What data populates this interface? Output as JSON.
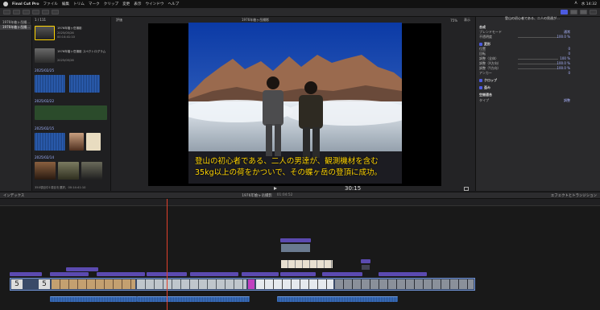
{
  "menubar": {
    "app": "Final Cut Pro",
    "items": [
      "ファイル",
      "編集",
      "トリム",
      "マーク",
      "クリップ",
      "変更",
      "表示",
      "ウインドウ",
      "ヘルプ"
    ],
    "right": [
      "A",
      "水 14:32"
    ]
  },
  "browser": {
    "header": "1 / 111",
    "clips": [
      {
        "title": "1976年槍ヶ岳撮影",
        "meta": "2025/05/26",
        "meta2": "00:14:41:10"
      },
      {
        "title": "1976年槍ヶ岳撮影 スペクトログラム",
        "meta": "2025/05/26",
        "meta2": "00:14:41:10"
      }
    ],
    "dates": [
      "2025/02/25",
      "2025/02/22",
      "2025/02/15",
      "2025/02/14"
    ],
    "footer": "350項目中1項目を選択、00:14:41:10"
  },
  "sidebar": {
    "items": [
      "1976年槍ヶ岳撮…",
      "1976年槍ヶ岳撮…"
    ]
  },
  "viewer": {
    "left": "評価",
    "title": "1976年槍ヶ岳撮影",
    "zoom": "75%",
    "view": "表示",
    "timecode": "30:15",
    "subtitle_line1": "登山の初心者である、二人の男達が、観測機材を含む",
    "subtitle_line2": "35kg以上の荷をかついで、その蝶ヶ岳の登頂に成功。"
  },
  "inspector": {
    "title": "登山の初心者である、二人の男達が…",
    "rows": [
      {
        "label": "合成",
        "section": true
      },
      {
        "label": "ブレンドモード",
        "value": "通常"
      },
      {
        "label": "不透明度",
        "value": "100.0 %"
      },
      {
        "label": "変形",
        "section": true,
        "checked": true
      },
      {
        "label": "位置",
        "value": "0"
      },
      {
        "label": "回転",
        "value": "0"
      },
      {
        "label": "調整（全体）",
        "value": "100 %"
      },
      {
        "label": "調整（X方向）",
        "value": "100.0 %"
      },
      {
        "label": "調整（Y方向）",
        "value": "100.0 %"
      },
      {
        "label": "アンカー",
        "value": "0"
      },
      {
        "label": "クロップ",
        "section": true,
        "checked": true
      },
      {
        "label": "歪み",
        "section": true,
        "checked": true
      },
      {
        "label": "空間適合",
        "section": true
      },
      {
        "label": "タイプ",
        "value": "調整"
      }
    ]
  },
  "timeline": {
    "index": "インデックス",
    "project": "1976年槍ヶ岳撮影",
    "duration": "01:04:52",
    "right": "エフェクトとトランジション"
  },
  "colors": {
    "accent": "#4c5be0",
    "subtitle": "#ffd400",
    "playhead": "#e0402a"
  }
}
